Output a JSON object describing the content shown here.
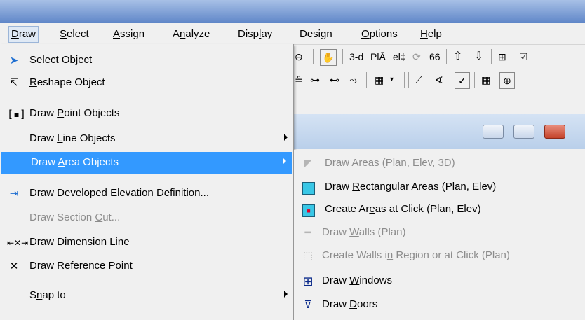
{
  "menubar": {
    "items": [
      {
        "label": "Draw",
        "underline": 0
      },
      {
        "label": "Select",
        "underline": 0
      },
      {
        "label": "Assign",
        "underline": 0
      },
      {
        "label": "Analyze",
        "underline": 1
      },
      {
        "label": "Display",
        "underline": 4
      },
      {
        "label": "Design",
        "underline": 4
      },
      {
        "label": "Options",
        "underline": 0
      },
      {
        "label": "Help",
        "underline": 0
      }
    ]
  },
  "toolbar": {
    "view_3d": "3-d",
    "plan_label": "PlĀ",
    "elev_label": "el‡"
  },
  "draw_menu": {
    "items": [
      {
        "label": "Select Object",
        "underline": 0,
        "icon": "pointer-icon"
      },
      {
        "label": "Reshape Object",
        "underline": 0,
        "icon": "reshape-icon"
      },
      {
        "label": "Draw Point Objects",
        "underline": 5,
        "icon": "point-object-icon"
      },
      {
        "label": "Draw Line Objects",
        "underline": 5
      },
      {
        "label": "Draw Area Objects",
        "underline": 5
      },
      {
        "label": "Draw Developed  Elevation Definition...",
        "underline": 5,
        "icon": "developed-elevation-icon"
      },
      {
        "label": "Draw Section Cut...",
        "underline": 13
      },
      {
        "label": "Draw Dimension Line",
        "underline": 7,
        "icon": "dimension-line-icon"
      },
      {
        "label": "Draw Reference Point",
        "underline": 20,
        "icon": "reference-point-icon"
      },
      {
        "label": "Snap to",
        "underline": 1
      }
    ]
  },
  "area_submenu": {
    "items": [
      {
        "label": "Draw Areas (Plan, Elev, 3D)",
        "underline": 5,
        "icon": "draw-areas-icon"
      },
      {
        "label": "Draw Rectangular Areas (Plan, Elev)",
        "underline": 5,
        "icon": "rectangular-area-icon"
      },
      {
        "label": "Create Areas at Click (Plan, Elev)",
        "underline": 9,
        "icon": "area-click-icon"
      },
      {
        "label": "Draw Walls (Plan)",
        "underline": 5,
        "icon": "walls-icon"
      },
      {
        "label": "Create Walls in Region or at Click (Plan)",
        "underline": 14,
        "icon": "walls-region-icon"
      },
      {
        "label": "Draw Windows",
        "underline": 5,
        "icon": "windows-icon"
      },
      {
        "label": "Draw Doors",
        "underline": 5,
        "icon": "doors-icon"
      }
    ]
  },
  "colors": {
    "selection": "#3399ff",
    "area_icon": "#39c7e6",
    "titlebar": "#5f86c8"
  }
}
